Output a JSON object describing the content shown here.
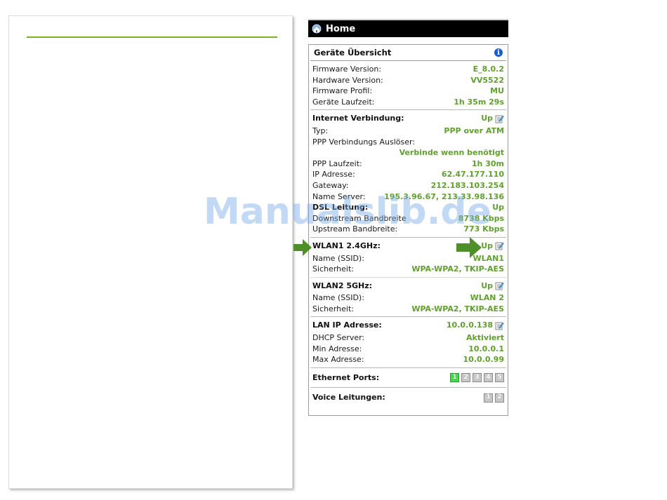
{
  "header": {
    "title": "Home"
  },
  "overview": {
    "title": "Geräte Übersicht",
    "rows": [
      {
        "label": "Firmware Version:",
        "value": "E_8.0.2"
      },
      {
        "label": "Hardware Version:",
        "value": "VV5522"
      },
      {
        "label": "Firmware Profil:",
        "value": "MU"
      },
      {
        "label": "Geräte Laufzeit:",
        "value": "1h 35m 29s"
      }
    ]
  },
  "internet": {
    "title": "Internet Verbindung:",
    "status": "Up",
    "typ_label": "Typ:",
    "typ_value": "PPP over ATM",
    "trigger_label": "PPP Verbindungs Auslöser:",
    "trigger_value": "Verbinde wenn benötigt",
    "rows": [
      {
        "label": "PPP Laufzeit:",
        "value": "1h 30m"
      },
      {
        "label": "IP Adresse:",
        "value": "62.47.177.110"
      },
      {
        "label": "Gateway:",
        "value": "212.183.103.254"
      },
      {
        "label": "Name Server:",
        "value": "195.3.96.67, 213.33.98.136"
      }
    ],
    "dsl_label": "DSL Leitung:",
    "dsl_status": "Up",
    "dsl_rows": [
      {
        "label": "Downstream Bandbreite",
        "value": "8738 Kbps"
      },
      {
        "label": "Upstream Bandbreite:",
        "value": "773 Kbps"
      }
    ]
  },
  "wlan1": {
    "title": "WLAN1 2.4GHz:",
    "status": "Up",
    "ssid_label": "Name (SSID):",
    "ssid_value": "WLAN1",
    "security_label": "Sicherheit:",
    "security_value": "WPA-WPA2, TKIP-AES"
  },
  "wlan2": {
    "title": "WLAN2 5GHz:",
    "status": "Up",
    "ssid_label": "Name (SSID):",
    "ssid_value": "WLAN 2",
    "security_label": "Sicherheit:",
    "security_value": "WPA-WPA2, TKIP-AES"
  },
  "lan": {
    "title": "LAN IP Adresse:",
    "ip": "10.0.0.138",
    "rows": [
      {
        "label": "DHCP Server:",
        "value": "Aktiviert"
      },
      {
        "label": "Min Adresse:",
        "value": "10.0.0.1"
      },
      {
        "label": "Max Adresse:",
        "value": "10.0.0.99"
      }
    ]
  },
  "ethernet": {
    "title": "Ethernet Ports:",
    "ports": [
      {
        "label": "1",
        "active": true
      },
      {
        "label": "2",
        "active": false
      },
      {
        "label": "3",
        "active": false
      },
      {
        "label": "4",
        "active": false
      },
      {
        "label": "5",
        "active": false
      }
    ]
  },
  "voice": {
    "title": "Voice Leitungen:",
    "lines": [
      {
        "label": "1",
        "active": false
      },
      {
        "label": "2",
        "active": false
      }
    ]
  },
  "watermark": "Manualslib.de",
  "colors": {
    "accent_green": "#5fa12c",
    "header_bg": "#000000",
    "port_active": "#46d84e",
    "info_blue": "#1a5fc7",
    "arrow_green": "#4f8f2a"
  },
  "icons": {
    "home": "home-globe-icon",
    "info": "info-icon",
    "edit": "edit-note-icon",
    "arrow": "arrow-right-icon"
  }
}
